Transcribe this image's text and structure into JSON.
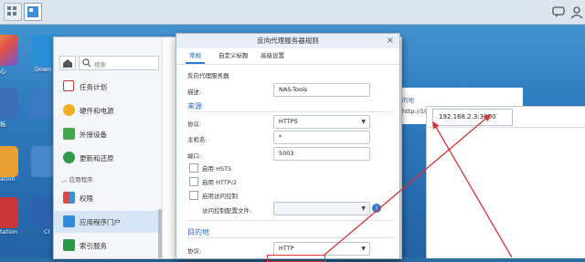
{
  "desktop": {
    "icons": [
      {
        "label": "心"
      },
      {
        "label": "Down"
      },
      {
        "label": "板"
      },
      {
        "label": "ation"
      },
      {
        "label": "tation"
      },
      {
        "label": "Cl"
      }
    ]
  },
  "control_panel": {
    "sidebar": {
      "search_placeholder": "搜索",
      "items": [
        {
          "label": "任务计划",
          "icon": "calendar-icon"
        },
        {
          "label": "硬件和电源",
          "icon": "bulb-icon"
        },
        {
          "label": "外接设备",
          "icon": "upload-icon"
        },
        {
          "label": "更新和还原",
          "icon": "refresh-icon"
        }
      ],
      "group_label": "应用程序",
      "app_items": [
        {
          "label": "权限",
          "icon": "grid-icon"
        },
        {
          "label": "应用程序门户",
          "icon": "portal-icon"
        },
        {
          "label": "索引服务",
          "icon": "index-icon"
        }
      ]
    }
  },
  "dialog": {
    "title": "反向代理服务器规则",
    "tabs": [
      "常规",
      "自定义标题",
      "高级设置"
    ],
    "heading": "反向代理服务器",
    "description_label": "描述:",
    "description_value": "NAS-Tools",
    "source_section": "来源",
    "source": {
      "protocol_label": "协议:",
      "protocol_value": "HTTPS",
      "hostname_label": "主机名:",
      "hostname_value": "*",
      "port_label": "端口:",
      "port_value": "5003"
    },
    "checkboxes": [
      "启用 HSTS",
      "启用 HTTP/2",
      "启用访问控制"
    ],
    "access_profile_label": "访问控制配置文件:",
    "destination_section": "目的地",
    "destination": {
      "protocol_label": "协议:",
      "protocol_value": "HTTP"
    }
  },
  "background_window": {
    "fragment_1": "的地",
    "fragment_2": "http://192."
  },
  "browser": {
    "address": "192.168.2.3:3000"
  },
  "accent": "#2f7bd1",
  "annotation_color": "#d33333"
}
